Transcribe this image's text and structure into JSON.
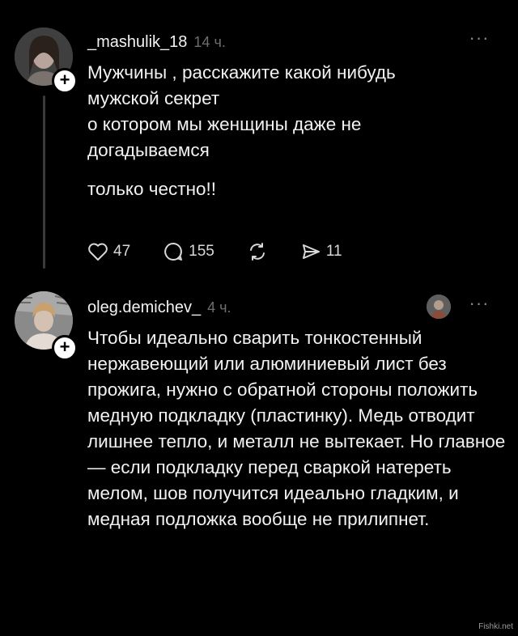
{
  "posts": [
    {
      "username": "_mashulik_18",
      "time": "14 ч.",
      "lines": [
        "Мужчины , расскажите какой нибудь",
        "мужской секрет",
        "о котором мы женщины  даже не",
        "догадываемся"
      ],
      "extra": "только честно!!",
      "likes": "47",
      "comments": "155",
      "shares": "11"
    },
    {
      "username": "oleg.demichev_",
      "time": "4 ч.",
      "text": "Чтобы идеально сварить тонкостенный нержавеющий или алюминиевый лист без прожига, нужно с обратной стороны положить медную подкладку (пластинку). Медь отводит лишнее тепло, и металл не вытекает. Но главное — если подкладку перед сваркой натереть мелом, шов получится идеально гладким, и медная подложка вообще не прилипнет."
    }
  ],
  "icons": {
    "more": "more-horizontal-icon",
    "plus": "plus-icon",
    "like": "heart-icon",
    "comment": "comment-icon",
    "repost": "repost-icon",
    "share": "send-icon"
  },
  "watermark": "Fishki.net"
}
